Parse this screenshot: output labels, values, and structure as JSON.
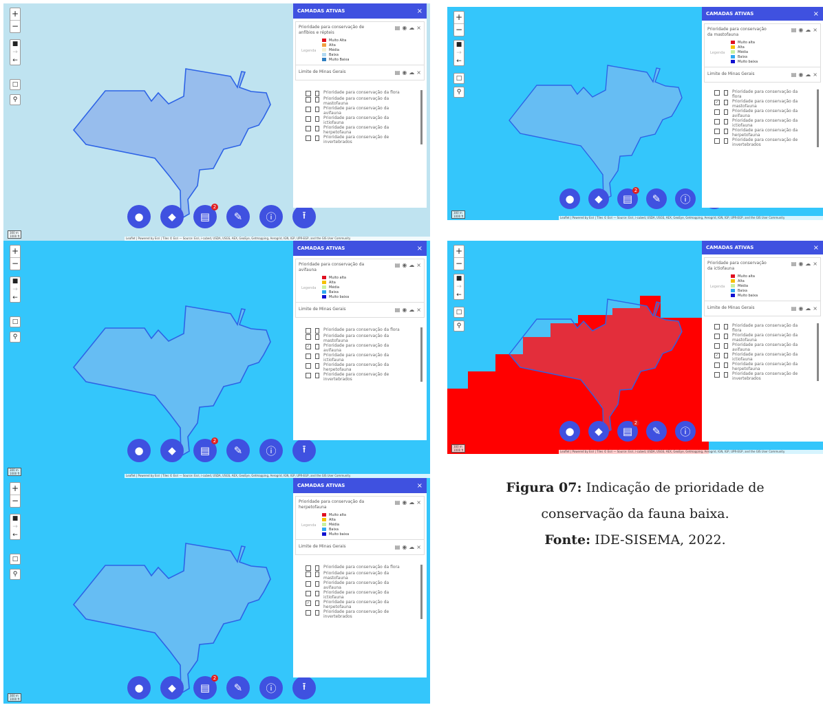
{
  "colors": {
    "map_bg_light": "#bfe3f0",
    "map_bg_blue": "#34c6fb",
    "polygon_fill": "#8fb6ec",
    "polygon_stroke": "#2d63e6",
    "raster_red": "#ff0000",
    "accent": "#3f51e0",
    "badge": "#e02020"
  },
  "sidebar_title": "CAMADAS ATIVAS",
  "close_glyph": "×",
  "limite_label": "Limite de Minas Gerais",
  "legend_title": "Legenda",
  "fab_icons": [
    "globe-icon",
    "layers-icon",
    "list-icon",
    "pen-icon",
    "info-icon",
    "upload-icon"
  ],
  "fab_glyphs": [
    "●",
    "◆",
    "▤",
    "✎",
    "ⓘ",
    "⭱"
  ],
  "fab_badge": "2",
  "zoom_in": "+",
  "zoom_out": "−",
  "attribution": "Leaflet | Powered by Esri | Tiles © Esri — Source: Esri, i-cubed, USDA, USGS, AEX, GeoEye, Getmapping, Aerogrid, IGN, IGP, UPR-EGP, and the GIS User Community",
  "scale": [
    "300 m",
    "1000 ft"
  ],
  "layer_list": [
    "Prioridade para conservação da flora",
    "Prioridade para conservação da mastofauna",
    "Prioridade para conservação da avifauna",
    "Prioridade para conservação da ictiofauna",
    "Prioridade para conservação da herpetofauna",
    "Prioridade para conservação de invertebrados"
  ],
  "panels": [
    {
      "name": "anfibios",
      "active_layer": "Prioridade para conservação de anfíbios e répteis",
      "legend": [
        "Muito Alta",
        "Alta",
        "Média",
        "Baixa",
        "Muito Baixa"
      ],
      "legend_colors": [
        "#e01020",
        "#f0a040",
        "#f5f0d0",
        "#b0d8f0",
        "#2f7fc0"
      ],
      "checked": -1
    },
    {
      "name": "mastofauna",
      "active_layer": "Prioridade para conservação da mastofauna",
      "legend": [
        "Muito alta",
        "Alta",
        "Média",
        "Baixa",
        "Muito baixa"
      ],
      "legend_colors": [
        "#e01020",
        "#f5c000",
        "#c8f0a0",
        "#30a8f0",
        "#1010d0"
      ],
      "checked": 1
    },
    {
      "name": "avifauna",
      "active_layer": "Prioridade para conservação da avifauna",
      "legend": [
        "Muito alta",
        "Alta",
        "Média",
        "Baixa",
        "Muito baixa"
      ],
      "legend_colors": [
        "#e01020",
        "#f5c000",
        "#c8f0a0",
        "#30a8f0",
        "#1010d0"
      ],
      "checked": 2
    },
    {
      "name": "ictiofauna",
      "active_layer": "Prioridade para conservação da ictiofauna",
      "legend": [
        "Muito alta",
        "Alta",
        "Média",
        "Baixa",
        "Muito baixa"
      ],
      "legend_colors": [
        "#e01020",
        "#f5c000",
        "#c8f0a0",
        "#30a8f0",
        "#1010d0"
      ],
      "checked": 3
    },
    {
      "name": "herpetofauna",
      "active_layer": "Prioridade para conservação da herpetofauna",
      "legend": [
        "Muito alta",
        "Alta",
        "Média",
        "Baixa",
        "Muito baixa"
      ],
      "legend_colors": [
        "#e01020",
        "#f5c000",
        "#c8f0a0",
        "#30a8f0",
        "#1010d0"
      ],
      "checked": 4
    }
  ],
  "caption": {
    "figure_label": "Figura 07:",
    "figure_text": "Indicação de prioridade de",
    "figure_text_2": "conservação da fauna baixa.",
    "source_label": "Fonte:",
    "source_text": "IDE-SISEMA, 2022."
  }
}
